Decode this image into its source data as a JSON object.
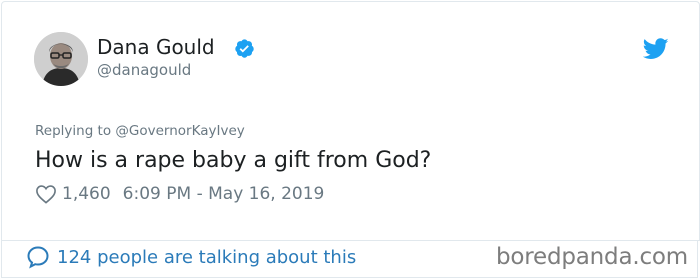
{
  "author": {
    "display_name": "Dana Gould",
    "handle": "@danagould",
    "verified": true,
    "avatar": "avatar-portrait"
  },
  "tweet": {
    "replying_prefix": "Replying to ",
    "replying_to": "@GovernorKayIvey",
    "text": "How is a rape baby a gift from God?",
    "likes": "1,460",
    "timestamp": "6:09 PM - May 16, 2019"
  },
  "footer": {
    "conversation_text": "124 people are talking about this"
  },
  "watermark": "boredpanda.com",
  "icons": {
    "verified": "verified-badge-icon",
    "brand": "twitter-bird-icon",
    "like": "heart-icon",
    "conversation": "speech-bubble-icon"
  },
  "colors": {
    "twitter_blue": "#1da1f2",
    "link_blue": "#2b7bb9",
    "text_primary": "#1c2022",
    "text_secondary": "#697882",
    "watermark": "#7d7d7d"
  }
}
